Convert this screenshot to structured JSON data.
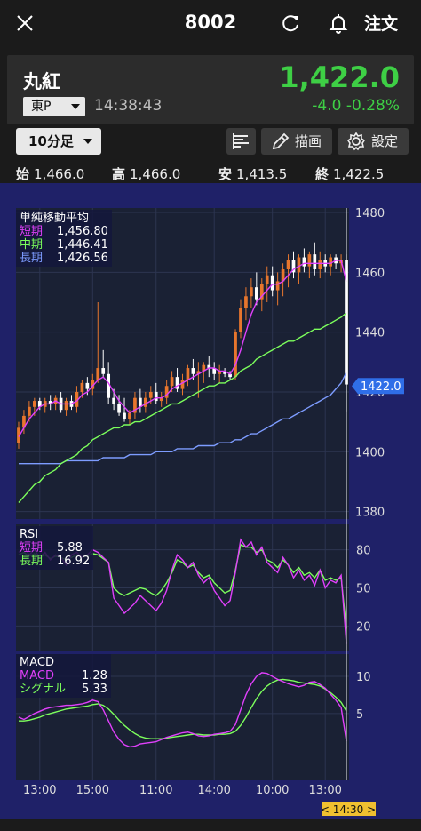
{
  "header": {
    "title": "8002",
    "order_label": "注文"
  },
  "quote": {
    "name": "丸紅",
    "market": "東P",
    "time": "14:38:43",
    "price": "1,422.0",
    "change": "-4.0  -0.28%"
  },
  "toolbar": {
    "interval": "10分足",
    "draw_label": "描画",
    "settings_label": "設定"
  },
  "ohlc": [
    {
      "k": "始",
      "v": "1,466.0"
    },
    {
      "k": "高",
      "v": "1,466.0"
    },
    {
      "k": "安",
      "v": "1,413.5"
    },
    {
      "k": "終",
      "v": "1,422.5"
    }
  ],
  "colors": {
    "up": "#e8762d",
    "down": "#ffffff",
    "ma_short": "#e040fb",
    "ma_mid": "#7cff5c",
    "ma_long": "#7d9cff",
    "rsi_short": "#e040fb",
    "rsi_long": "#7cff5c",
    "macd": "#e040fb",
    "signal": "#7cff5c",
    "price_tag": "#2f6ee8",
    "time_tag": "#f0c030"
  },
  "chart_data": [
    {
      "type": "candlestick",
      "title": "単純移動平均",
      "legend": [
        {
          "name": "短期",
          "value": "1,456.80"
        },
        {
          "name": "中期",
          "value": "1,446.41"
        },
        {
          "name": "長期",
          "value": "1,426.56"
        }
      ],
      "y_ticks": [
        "1480",
        "1460",
        "1440",
        "1420",
        "1400",
        "1380"
      ],
      "ylim": [
        1377.5,
        1481.5
      ],
      "current_price_label": "1422.0",
      "current_price": 1422.0,
      "candles": [
        [
          1403,
          1410,
          1401,
          1408
        ],
        [
          1408,
          1414,
          1406,
          1412
        ],
        [
          1412,
          1417,
          1410,
          1415
        ],
        [
          1415,
          1418,
          1412,
          1417
        ],
        [
          1417,
          1418,
          1414,
          1415
        ],
        [
          1415,
          1418,
          1413,
          1417
        ],
        [
          1417,
          1419,
          1414,
          1416
        ],
        [
          1416,
          1419,
          1414,
          1418
        ],
        [
          1418,
          1420,
          1413,
          1414
        ],
        [
          1414,
          1418,
          1412,
          1417
        ],
        [
          1417,
          1419,
          1414,
          1415
        ],
        [
          1415,
          1422,
          1413,
          1420
        ],
        [
          1420,
          1424,
          1418,
          1423
        ],
        [
          1423,
          1425,
          1419,
          1421
        ],
        [
          1421,
          1426,
          1419,
          1424
        ],
        [
          1424,
          1450,
          1423,
          1428
        ],
        [
          1428,
          1434,
          1425,
          1426
        ],
        [
          1426,
          1430,
          1416,
          1418
        ],
        [
          1418,
          1421,
          1414,
          1416
        ],
        [
          1416,
          1419,
          1412,
          1413
        ],
        [
          1413,
          1418,
          1410,
          1411
        ],
        [
          1411,
          1414,
          1409,
          1413
        ],
        [
          1413,
          1420,
          1411,
          1418
        ],
        [
          1418,
          1421,
          1413,
          1415
        ],
        [
          1415,
          1420,
          1413,
          1418
        ],
        [
          1418,
          1422,
          1416,
          1420
        ],
        [
          1420,
          1423,
          1416,
          1417
        ],
        [
          1417,
          1420,
          1415,
          1418
        ],
        [
          1418,
          1424,
          1416,
          1422
        ],
        [
          1422,
          1427,
          1420,
          1425
        ],
        [
          1425,
          1428,
          1420,
          1421
        ],
        [
          1421,
          1426,
          1419,
          1424
        ],
        [
          1424,
          1429,
          1422,
          1428
        ],
        [
          1428,
          1431,
          1424,
          1426
        ],
        [
          1426,
          1430,
          1418,
          1427
        ],
        [
          1427,
          1430,
          1423,
          1429
        ],
        [
          1429,
          1432,
          1425,
          1428
        ],
        [
          1428,
          1430,
          1424,
          1426
        ],
        [
          1426,
          1429,
          1423,
          1427
        ],
        [
          1427,
          1428,
          1425,
          1426
        ],
        [
          1426,
          1427,
          1424,
          1425
        ],
        [
          1425,
          1441,
          1424,
          1440
        ],
        [
          1440,
          1451,
          1438,
          1448
        ],
        [
          1448,
          1455,
          1444,
          1452
        ],
        [
          1452,
          1458,
          1448,
          1455
        ],
        [
          1455,
          1460,
          1449,
          1451
        ],
        [
          1451,
          1458,
          1447,
          1456
        ],
        [
          1456,
          1462,
          1450,
          1459
        ],
        [
          1459,
          1462,
          1452,
          1454
        ],
        [
          1454,
          1460,
          1449,
          1457
        ],
        [
          1457,
          1463,
          1452,
          1461
        ],
        [
          1461,
          1466,
          1455,
          1464
        ],
        [
          1464,
          1467,
          1458,
          1460
        ],
        [
          1460,
          1466,
          1456,
          1465
        ],
        [
          1465,
          1468,
          1460,
          1462
        ],
        [
          1462,
          1467,
          1458,
          1466
        ],
        [
          1466,
          1470,
          1459,
          1461
        ],
        [
          1461,
          1467,
          1458,
          1464
        ],
        [
          1464,
          1466,
          1460,
          1462
        ],
        [
          1462,
          1466,
          1459,
          1465
        ],
        [
          1465,
          1466,
          1461,
          1463
        ],
        [
          1463,
          1466,
          1460,
          1464
        ],
        [
          1464,
          1466,
          1413.5,
          1422.5
        ]
      ],
      "ma_short": [
        1405,
        1408,
        1411,
        1413,
        1415,
        1416,
        1416,
        1417,
        1416,
        1416,
        1416,
        1417,
        1419,
        1420,
        1422,
        1424,
        1425,
        1423,
        1420,
        1417,
        1415,
        1413,
        1414,
        1415,
        1416,
        1417,
        1418,
        1418,
        1419,
        1421,
        1422,
        1423,
        1424,
        1425,
        1426,
        1427,
        1428,
        1428,
        1427,
        1427,
        1426,
        1429,
        1434,
        1440,
        1446,
        1450,
        1452,
        1454,
        1456,
        1456,
        1457,
        1459,
        1461,
        1462,
        1463,
        1463,
        1463,
        1463,
        1463,
        1463,
        1464,
        1464,
        1456.8
      ],
      "ma_mid": [
        1383,
        1385,
        1387,
        1389,
        1390,
        1392,
        1393,
        1394,
        1396,
        1397,
        1398,
        1399,
        1401,
        1402,
        1404,
        1405,
        1406,
        1407,
        1408,
        1408,
        1409,
        1409,
        1410,
        1410,
        1411,
        1412,
        1413,
        1414,
        1415,
        1416,
        1416,
        1417,
        1418,
        1419,
        1420,
        1421,
        1422,
        1422,
        1423,
        1423,
        1424,
        1425,
        1427,
        1428,
        1429,
        1431,
        1432,
        1433,
        1434,
        1435,
        1436,
        1437,
        1437,
        1438,
        1439,
        1440,
        1441,
        1441,
        1442,
        1443,
        1444,
        1445,
        1446.4
      ],
      "ma_long": [
        1396,
        1396,
        1396,
        1396,
        1396,
        1396,
        1396,
        1396,
        1396,
        1397,
        1397,
        1397,
        1397,
        1397,
        1397,
        1397,
        1398,
        1398,
        1398,
        1398,
        1398,
        1399,
        1399,
        1399,
        1399,
        1399,
        1400,
        1400,
        1400,
        1400,
        1401,
        1401,
        1401,
        1401,
        1402,
        1402,
        1402,
        1402,
        1403,
        1403,
        1403,
        1404,
        1404,
        1405,
        1406,
        1406,
        1407,
        1408,
        1409,
        1410,
        1411,
        1411,
        1412,
        1413,
        1414,
        1415,
        1416,
        1417,
        1418,
        1419,
        1421,
        1423,
        1426.6
      ]
    },
    {
      "type": "line",
      "title": "RSI",
      "legend": [
        {
          "name": "短期",
          "value": "5.88"
        },
        {
          "name": "長期",
          "value": "16.92"
        }
      ],
      "y_ticks": [
        "80",
        "50",
        "20"
      ],
      "ylim": [
        0,
        100
      ],
      "series": [
        {
          "name": "短期",
          "values": [
            78,
            82,
            76,
            80,
            74,
            78,
            72,
            76,
            74,
            68,
            76,
            78,
            74,
            76,
            80,
            78,
            74,
            70,
            42,
            36,
            30,
            34,
            38,
            44,
            40,
            36,
            32,
            38,
            48,
            64,
            76,
            72,
            66,
            70,
            60,
            54,
            58,
            48,
            42,
            36,
            40,
            62,
            88,
            82,
            86,
            76,
            82,
            70,
            66,
            62,
            74,
            68,
            58,
            64,
            56,
            60,
            52,
            64,
            50,
            56,
            54,
            60,
            6
          ],
          "named": true
        },
        {
          "name": "長期",
          "values": [
            76,
            78,
            75,
            77,
            74,
            76,
            73,
            75,
            74,
            72,
            74,
            76,
            74,
            75,
            77,
            76,
            73,
            70,
            50,
            46,
            44,
            46,
            48,
            50,
            49,
            46,
            44,
            48,
            54,
            62,
            72,
            70,
            66,
            68,
            62,
            58,
            60,
            54,
            50,
            46,
            48,
            64,
            84,
            82,
            82,
            78,
            80,
            72,
            70,
            66,
            72,
            68,
            62,
            66,
            60,
            62,
            58,
            64,
            56,
            58,
            56,
            58,
            18
          ],
          "named": true
        }
      ]
    },
    {
      "type": "line",
      "title": "MACD",
      "legend": [
        {
          "name": "MACD",
          "value": "1.28"
        },
        {
          "name": "シグナル",
          "value": "5.33"
        }
      ],
      "y_ticks": [
        "10",
        "5"
      ],
      "ylim": [
        -4,
        13
      ],
      "series": [
        {
          "name": "MACD",
          "values": [
            4.5,
            4.2,
            4.6,
            5.0,
            5.3,
            5.6,
            5.8,
            5.9,
            6.0,
            6.1,
            6.1,
            6.2,
            6.3,
            6.5,
            6.8,
            6.6,
            5.5,
            4.0,
            2.5,
            1.5,
            0.8,
            0.5,
            0.6,
            0.9,
            1.0,
            1.1,
            1.2,
            1.5,
            1.8,
            2.0,
            2.2,
            2.4,
            2.5,
            2.3,
            2.0,
            1.9,
            2.0,
            2.2,
            2.3,
            2.4,
            2.6,
            3.5,
            5.5,
            7.5,
            9.0,
            10.0,
            10.5,
            10.4,
            10.0,
            9.6,
            9.3,
            9.0,
            8.8,
            8.6,
            8.8,
            9.2,
            9.3,
            8.9,
            8.4,
            7.6,
            6.8,
            5.8,
            1.28
          ]
        },
        {
          "name": "シグナル",
          "values": [
            4.0,
            4.0,
            4.1,
            4.3,
            4.5,
            4.8,
            5.0,
            5.2,
            5.4,
            5.6,
            5.7,
            5.8,
            5.9,
            6.0,
            6.2,
            6.3,
            6.1,
            5.6,
            4.9,
            4.1,
            3.4,
            2.8,
            2.3,
            1.9,
            1.7,
            1.6,
            1.6,
            1.6,
            1.7,
            1.8,
            1.9,
            2.0,
            2.1,
            2.2,
            2.2,
            2.1,
            2.1,
            2.1,
            2.2,
            2.2,
            2.3,
            2.6,
            3.4,
            4.5,
            5.8,
            7.0,
            8.0,
            8.7,
            9.2,
            9.5,
            9.6,
            9.5,
            9.4,
            9.2,
            9.1,
            9.0,
            8.9,
            8.7,
            8.3,
            7.8,
            7.2,
            6.5,
            5.33
          ]
        }
      ]
    }
  ],
  "x_axis": {
    "labels": [
      "13:00",
      "15:00",
      "11:00",
      "14:00",
      "10:00",
      "13:00"
    ],
    "current_time_label": "< 14:30 >"
  }
}
